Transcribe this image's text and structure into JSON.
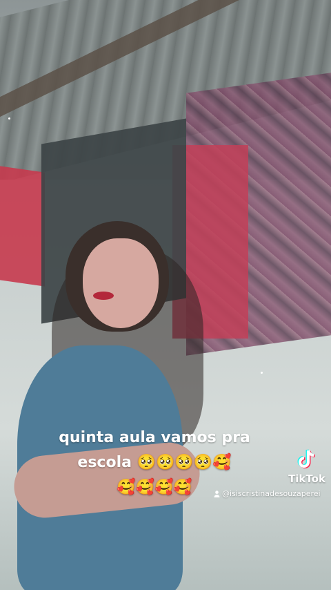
{
  "caption": {
    "line1": "quinta aula vamos pra",
    "line2": "escola 🥺🥺🥺🥺🥰",
    "line3": "🥰🥰🥰🥰"
  },
  "watermark": {
    "brand": "TikTok",
    "handle": "@isiscristinadesouzaperei",
    "icon": "tiktok-logo-icon",
    "user_icon": "person-icon"
  },
  "colors": {
    "caption_text": "#ffffff",
    "tiktok_cyan": "#25f4ee",
    "tiktok_pink": "#fe2c55"
  }
}
